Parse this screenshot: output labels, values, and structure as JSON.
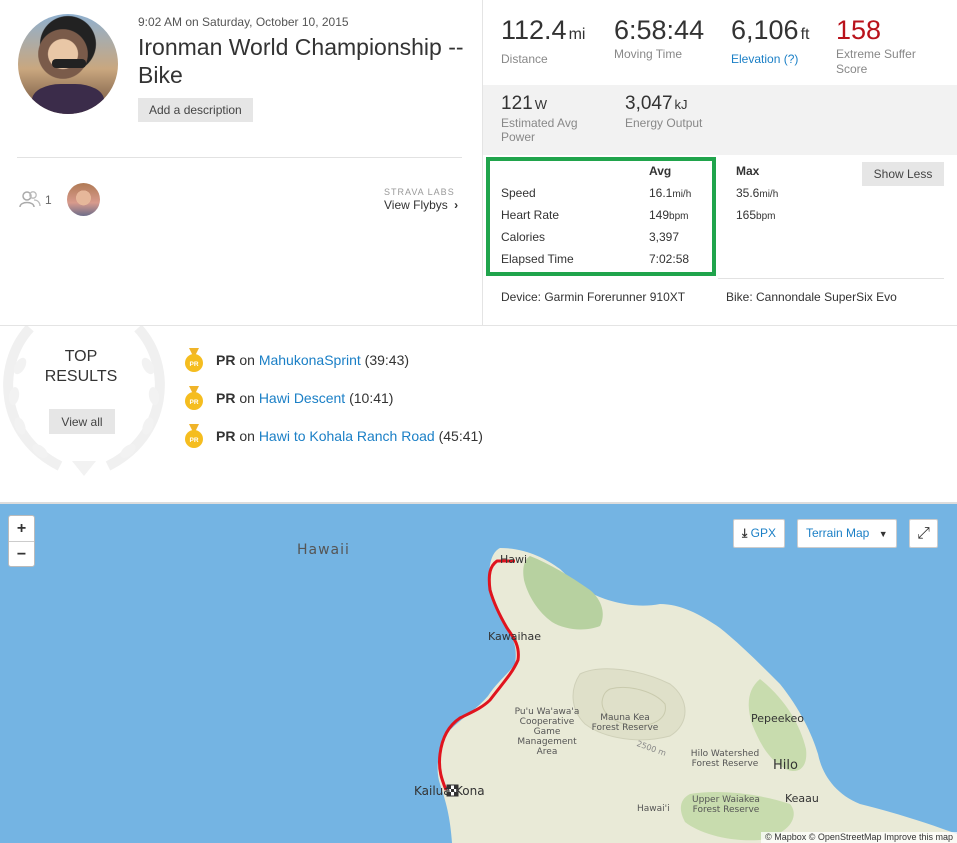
{
  "activity": {
    "date_line": "9:02 AM on Saturday, October 10, 2015",
    "title": "Ironman World Championship -- Bike",
    "add_description": "Add a description",
    "kudos_count": "1",
    "labs_label": "STRAVA LABS",
    "flybys_label": "View Flybys"
  },
  "stats": {
    "distance": {
      "value": "112.4",
      "unit": "mi",
      "label": "Distance"
    },
    "moving_time": {
      "value": "6:58:44",
      "label": "Moving Time"
    },
    "elevation": {
      "value": "6,106",
      "unit": "ft",
      "label": "Elevation (?)"
    },
    "suffer": {
      "value": "158",
      "label_1": "Extreme Suffer",
      "label_2": "Score"
    },
    "power": {
      "value": "121",
      "unit": "W",
      "label_1": "Estimated Avg",
      "label_2": "Power"
    },
    "energy": {
      "value": "3,047",
      "unit": "kJ",
      "label": "Energy Output"
    }
  },
  "more_stats": {
    "avg_header": "Avg",
    "max_header": "Max",
    "show_less": "Show Less",
    "rows": [
      {
        "label": "Speed",
        "avg": "16.1",
        "avg_unit": "mi/h",
        "max": "35.6",
        "max_unit": "mi/h"
      },
      {
        "label": "Heart Rate",
        "avg": "149",
        "avg_unit": "bpm",
        "max": "165",
        "max_unit": "bpm"
      },
      {
        "label": "Calories",
        "avg": "3,397"
      },
      {
        "label": "Elapsed Time",
        "avg": "7:02:58"
      }
    ],
    "device": "Device: Garmin Forerunner 910XT",
    "bike": "Bike: Cannondale SuperSix Evo"
  },
  "top_results": {
    "title_1": "TOP",
    "title_2": "RESULTS",
    "view_all": "View all",
    "items": [
      {
        "badge": "PR",
        "prefix": "PR",
        "on": "on",
        "segment": "MahukonaSprint",
        "time": "(39:43)"
      },
      {
        "badge": "PR",
        "prefix": "PR",
        "on": "on",
        "segment": "Hawi Descent",
        "time": "(10:41)"
      },
      {
        "badge": "PR",
        "prefix": "PR",
        "on": "on",
        "segment": "Hawi to Kohala Ranch Road",
        "time": "(45:41)"
      }
    ]
  },
  "map": {
    "zoom_in": "+",
    "zoom_out": "−",
    "gpx": "GPX",
    "terrain": "Terrain Map",
    "labels": {
      "hawaii": "Hawaii",
      "hawi": "Hawi",
      "kawaihae": "Kawaihae",
      "puu_1": "Pu'u Wa'awa'a",
      "puu_2": "Cooperative",
      "puu_3": "Game",
      "puu_4": "Management",
      "puu_5": "Area",
      "mauna_1": "Mauna Kea",
      "mauna_2": "Forest Reserve",
      "elev": "2500 m",
      "pepeekeo": "Pepeekeo",
      "hilo_ws_1": "Hilo Watershed",
      "hilo_ws_2": "Forest Reserve",
      "hilo": "Hilo",
      "kailua": "Kailua-Kona",
      "keaau": "Keaau",
      "waiakea_1": "Upper Waiakea",
      "waiakea_2": "Forest Reserve",
      "hawaii_small": "Hawai'i"
    },
    "attribution": "© Mapbox © OpenStreetMap Improve this map",
    "colors": {
      "water": "#74b4e3",
      "route": "#e0141e",
      "land": "#e9ead7"
    }
  }
}
